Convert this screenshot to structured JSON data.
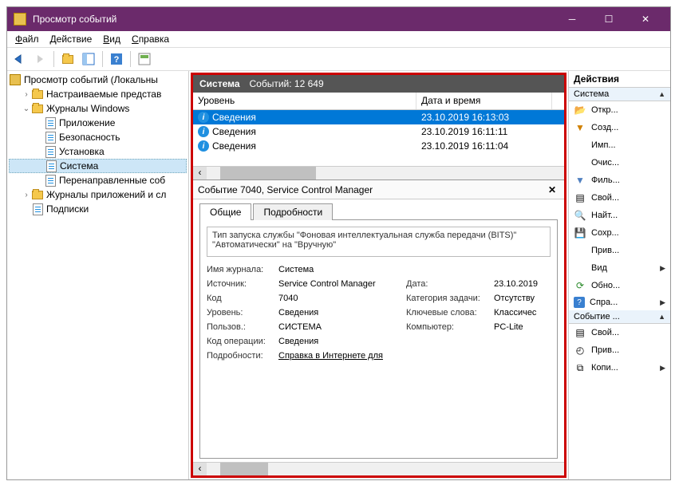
{
  "window": {
    "title": "Просмотр событий"
  },
  "menu": {
    "file": "Файл",
    "action": "Действие",
    "view": "Вид",
    "help": "Справка"
  },
  "tree": {
    "root": "Просмотр событий (Локальны",
    "custom": "Настраиваемые представ",
    "windows": "Журналы Windows",
    "app": "Приложение",
    "security": "Безопасность",
    "setup": "Установка",
    "system": "Система",
    "forwarded": "Перенаправленные соб",
    "appsvc": "Журналы приложений и сл",
    "subs": "Подписки"
  },
  "header": {
    "name": "Система",
    "count": "Событий: 12 649"
  },
  "grid": {
    "col_level": "Уровень",
    "col_dt": "Дата и время",
    "rows": [
      {
        "level": "Сведения",
        "dt": "23.10.2019 16:13:03",
        "sel": true
      },
      {
        "level": "Сведения",
        "dt": "23.10.2019 16:11:11",
        "sel": false
      },
      {
        "level": "Сведения",
        "dt": "23.10.2019 16:11:04",
        "sel": false
      }
    ]
  },
  "event": {
    "title": "Событие 7040, Service Control Manager",
    "tab_general": "Общие",
    "tab_details": "Подробности",
    "desc": "Тип запуска службы \"Фоновая интеллектуальная служба передачи (BITS)\" \"Автоматически\" на \"Вручную\"",
    "lbl_log": "Имя журнала:",
    "val_log": "Система",
    "lbl_src": "Источник:",
    "val_src": "Service Control Manager",
    "lbl_date": "Дата:",
    "val_date": "23.10.2019",
    "lbl_code": "Код",
    "val_code": "7040",
    "lbl_task": "Категория задачи:",
    "val_task": "Отсутству",
    "lbl_level": "Уровень:",
    "val_level": "Сведения",
    "lbl_kw": "Ключевые слова:",
    "val_kw": "Классичес",
    "lbl_user": "Пользов.:",
    "val_user": "СИСТЕМА",
    "lbl_comp": "Компьютер:",
    "val_comp": "PC-Lite",
    "lbl_op": "Код операции:",
    "val_op": "Сведения",
    "lbl_info": "Подробности:",
    "val_info": "Справка в Интернете для "
  },
  "actions": {
    "pane": "Действия",
    "sec1": "Система",
    "open": "Откр...",
    "create": "Созд...",
    "import": "Имп...",
    "clear": "Очис...",
    "filter": "Филь...",
    "props": "Свой...",
    "find": "Найт...",
    "save": "Сохр...",
    "attach": "Прив...",
    "view": "Вид",
    "refresh": "Обно...",
    "help": "Спра...",
    "sec2": "Событие ...",
    "props2": "Свой...",
    "attach2": "Прив...",
    "copy": "Копи..."
  }
}
